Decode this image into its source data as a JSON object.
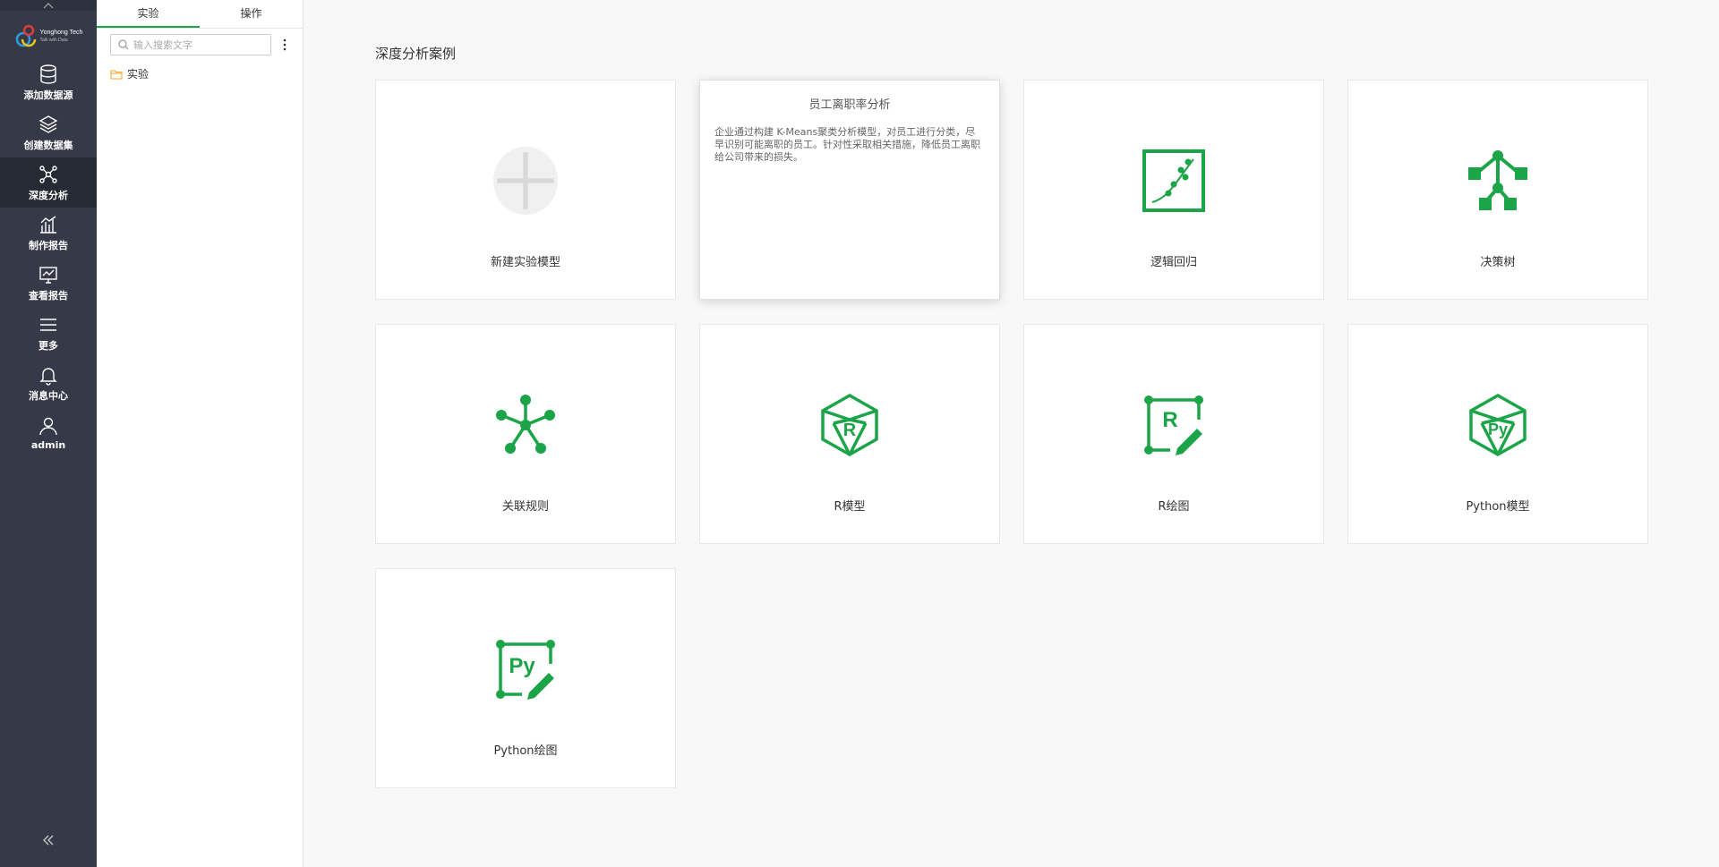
{
  "nav": {
    "logo": {
      "brand": "Yonghong Tech",
      "tagline": "Talk with Data"
    },
    "items": [
      {
        "label": "添加数据源",
        "icon": "database-icon"
      },
      {
        "label": "创建数据集",
        "icon": "layers-icon"
      },
      {
        "label": "深度分析",
        "icon": "network-icon"
      },
      {
        "label": "制作报告",
        "icon": "bar-chart-icon"
      },
      {
        "label": "查看报告",
        "icon": "monitor-chart-icon"
      },
      {
        "label": "更多",
        "icon": "menu-icon"
      },
      {
        "label": "消息中心",
        "icon": "bell-icon"
      },
      {
        "label": "admin",
        "icon": "user-icon"
      }
    ],
    "active": "深度分析"
  },
  "panel": {
    "tabs": [
      {
        "label": "实验"
      },
      {
        "label": "操作"
      }
    ],
    "active_tab": "实验",
    "search": {
      "placeholder": "输入搜索文字",
      "value": ""
    },
    "tree": [
      {
        "label": "实验",
        "icon": "folder-icon"
      }
    ]
  },
  "main": {
    "section_title": "深度分析案例",
    "cards": [
      {
        "label": "新建实验模型",
        "icon": "plus-icon"
      },
      {
        "case_title": "员工离职率分析",
        "description": "企业通过构建 K-Means聚类分析模型，对员工进行分类，尽早识别可能离职的员工。针对性采取相关措施，降低员工离职给公司带来的损失。"
      },
      {
        "label": "逻辑回归",
        "icon": "logistic-regression-icon"
      },
      {
        "label": "决策树",
        "icon": "decision-tree-icon"
      },
      {
        "label": "关联规则",
        "icon": "association-rule-icon"
      },
      {
        "label": "R模型",
        "icon": "r-model-icon"
      },
      {
        "label": "R绘图",
        "icon": "r-plot-icon"
      },
      {
        "label": "Python模型",
        "icon": "python-model-icon"
      },
      {
        "label": "Python绘图",
        "icon": "python-plot-icon"
      }
    ]
  },
  "colors": {
    "accent": "#1ba548",
    "nav_bg": "#363a48",
    "nav_active": "#262a35",
    "folder": "#f0a830"
  }
}
